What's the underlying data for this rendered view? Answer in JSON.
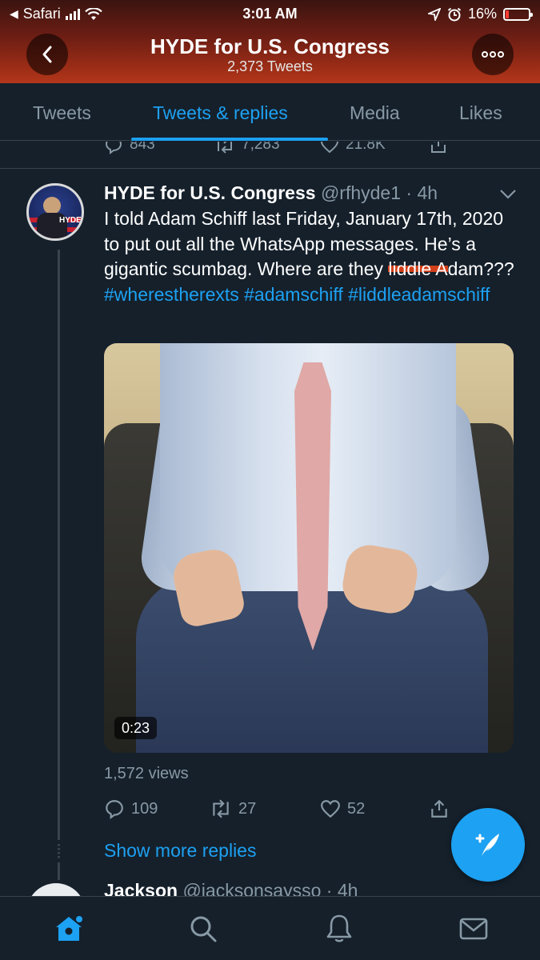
{
  "status_bar": {
    "back_app": "Safari",
    "time": "3:01 AM",
    "battery_percent": "16%",
    "battery_level": 0.16
  },
  "header": {
    "title": "HYDE for U.S. Congress",
    "subtitle": "2,373 Tweets"
  },
  "tabs": [
    {
      "label": "Tweets",
      "active": false
    },
    {
      "label": "Tweets & replies",
      "active": true
    },
    {
      "label": "Media",
      "active": false
    },
    {
      "label": "Likes",
      "active": false
    }
  ],
  "prev_tweet_actions": {
    "replies": "843",
    "retweets": "7,283",
    "likes": "21.8K"
  },
  "tweet": {
    "name": "HYDE for U.S. Congress",
    "handle": "@rfhyde1",
    "time": "4h",
    "text_1": "I told Adam Schiff last Friday, January 17th, 2020 to put out all the WhatsApp messages. He’s a gigantic scumbag. Where are they ",
    "text_marked": "liddle A",
    "text_2": "dam??? ",
    "hashtags": [
      "#wherestherexts",
      "#adamschiff",
      "#liddleadamschiff"
    ],
    "avatar_badge": "HYDE",
    "video_duration": "0:23",
    "views": "1,572 views",
    "replies": "109",
    "retweets": "27",
    "likes": "52"
  },
  "show_more": "Show more replies",
  "next_reply": {
    "name": "Jackson",
    "handle": "@jacksonsaysso",
    "time": "4h"
  },
  "colors": {
    "accent": "#1da1f2",
    "background": "#15202b",
    "muted": "#8899a6",
    "border": "#38444d"
  }
}
